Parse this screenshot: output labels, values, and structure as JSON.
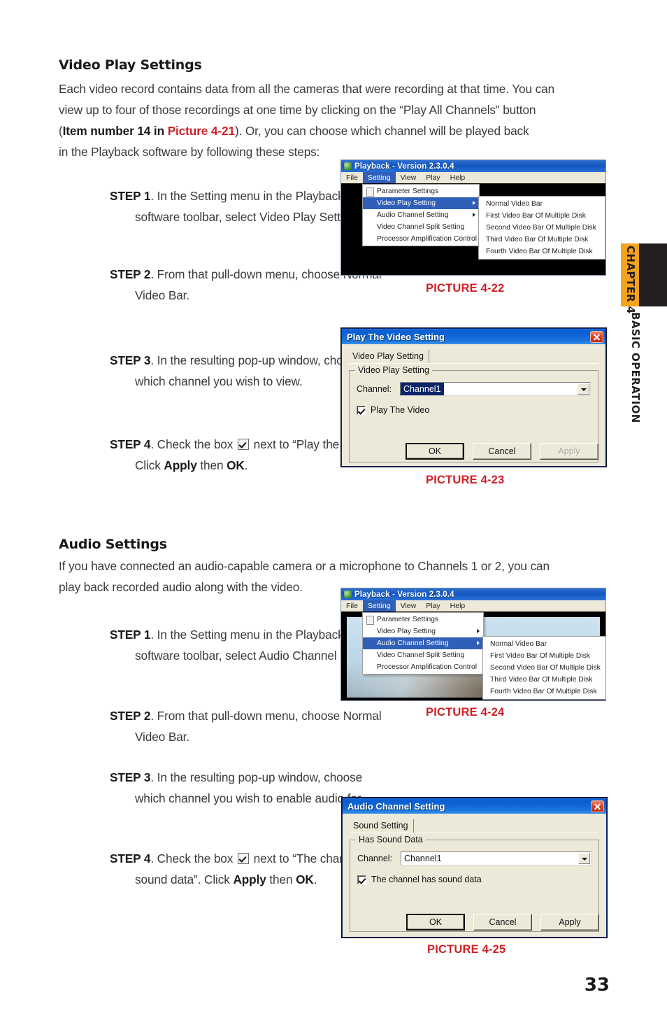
{
  "chapter_tab": {
    "chapter": "CHAPTER 4",
    "section": "BASIC OPERATION",
    "orange": "#f6a21d",
    "black": "#231f20"
  },
  "page_number": "33",
  "sections": [
    {
      "heading": "Video Play Settings",
      "intro_line1": "Each video record contains data from all the cameras that were recording at that time. You can",
      "intro_line2": "view up to four of those recordings at one time by clicking on the “Play All Channels” button",
      "intro_line3_pre": "(",
      "intro_line3_bold": "Item number 14 in ",
      "intro_line3_red": "Picture 4-21",
      "intro_line3_post": "). Or, you can choose which channel will be played back",
      "intro_line4": "in the Playback software by following these steps:",
      "steps": [
        {
          "label": "STEP 1",
          "text": ". In the Setting menu in the Playback software toolbar, select Video Play Setting"
        },
        {
          "label": "STEP 2",
          "text": ". From that pull-down menu, choose Normal Video Bar."
        },
        {
          "label": "STEP 3",
          "text": ". In the resulting pop-up window, choose which channel you wish to view."
        },
        {
          "label": "STEP 4",
          "pre": ". Check the box ",
          "post_a": " next to “Play the Video”. Click ",
          "bold_a": "Apply",
          "mid": " then ",
          "bold_b": "OK",
          "end": "."
        }
      ]
    },
    {
      "heading": "Audio Settings",
      "intro_line1": "If you have connected an audio-capable camera or a microphone to Channels 1 or 2, you can",
      "intro_line2": "play back recorded audio along with the video.",
      "steps": [
        {
          "label": "STEP 1",
          "text": ". In the Setting menu in the Playback software toolbar, select Audio Channel Setting."
        },
        {
          "label": "STEP 2",
          "text": ". From that pull-down menu, choose Normal Video Bar."
        },
        {
          "label": "STEP 3",
          "text": ". In the resulting pop-up window, choose which channel you wish to enable audio for."
        },
        {
          "label": "STEP 4",
          "pre": ". Check the box ",
          "post_a": " next to “The channel has sound data”. Click ",
          "bold_a": "Apply",
          "mid": " then ",
          "bold_b": "OK",
          "end": "."
        }
      ]
    }
  ],
  "captions": {
    "pic22": "PICTURE 4-22",
    "pic23": "PICTURE 4-23",
    "pic24": "PICTURE 4-24",
    "pic25": "PICTURE 4-25"
  },
  "playback_window": {
    "title": "Playback - Version 2.3.0.4",
    "menubar": [
      "File",
      "Setting",
      "View",
      "Play",
      "Help"
    ],
    "selected_menu": "Setting",
    "menu_items": [
      "Parameter Settings",
      "Video Play Setting",
      "Audio Channel Setting",
      "Video Channel Split Setting",
      "Processor Amplification Control"
    ],
    "submenu_items": [
      "Normal Video Bar",
      "First Video Bar Of Multiple Disk",
      "Second Video Bar Of Multiple Disk",
      "Third Video Bar Of Multiple Disk",
      "Fourth Video Bar Of Multiple Disk"
    ],
    "highlight_pic22": "Video Play Setting",
    "highlight_pic24": "Audio Channel Setting"
  },
  "video_dialog": {
    "title": "Play The Video Setting",
    "tab": "Video Play Setting",
    "group_legend": "Video Play Setting",
    "channel_label": "Channel:",
    "channel_value": "Channel1",
    "checkbox_label": "Play The Video",
    "buttons": {
      "ok": "OK",
      "cancel": "Cancel",
      "apply": "Apply"
    }
  },
  "audio_dialog": {
    "title": "Audio Channel Setting",
    "tab": "Sound Setting",
    "group_legend": "Has Sound Data",
    "channel_label": "Channel:",
    "channel_value": "Channel1",
    "checkbox_label": "The channel has sound data",
    "buttons": {
      "ok": "OK",
      "cancel": "Cancel",
      "apply": "Apply"
    }
  }
}
